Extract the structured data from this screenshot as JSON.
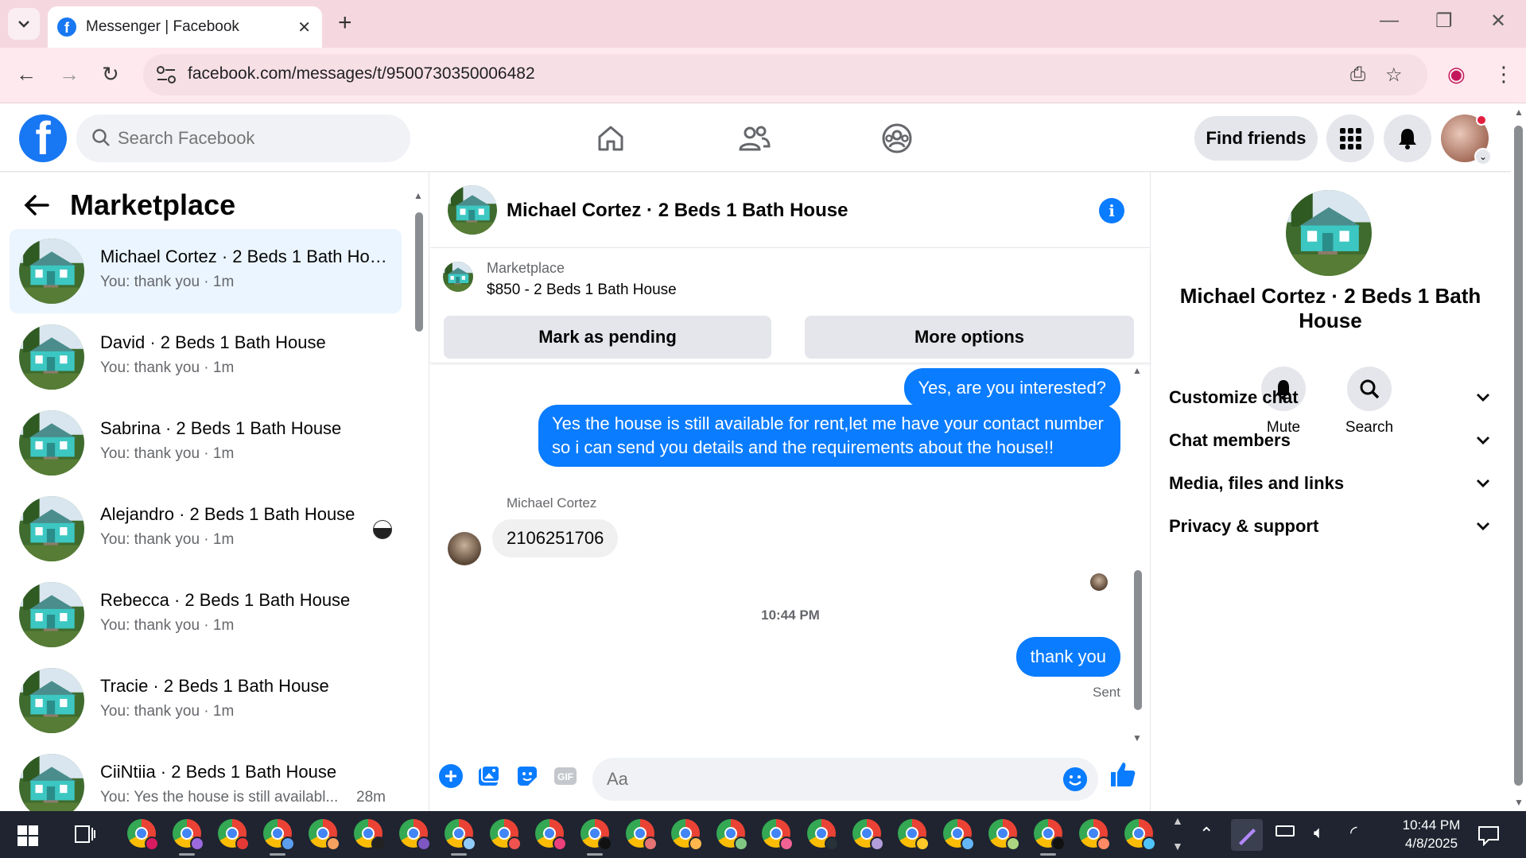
{
  "browser": {
    "tab_title": "Messenger | Facebook",
    "url": "facebook.com/messages/t/9500730350006482"
  },
  "header": {
    "search_placeholder": "Search Facebook",
    "find_friends": "Find friends"
  },
  "left": {
    "title": "Marketplace",
    "conversations": [
      {
        "name": "Michael Cortez · 2 Beds 1 Bath House",
        "preview": "You: thank you · 1m",
        "time": "",
        "active": true
      },
      {
        "name": "David · 2 Beds 1 Bath House",
        "preview": "You: thank you · 1m",
        "time": ""
      },
      {
        "name": "Sabrina · 2 Beds 1 Bath House",
        "preview": "You: thank you · 1m",
        "time": ""
      },
      {
        "name": "Alejandro · 2 Beds 1 Bath House",
        "preview": "You: thank you · 1m",
        "time": ""
      },
      {
        "name": "Rebecca · 2 Beds 1 Bath House",
        "preview": "You: thank you · 1m",
        "time": ""
      },
      {
        "name": "Tracie · 2 Beds 1 Bath House",
        "preview": "You: thank you · 1m",
        "time": ""
      },
      {
        "name": "CiiNtiia · 2 Beds 1 Bath House",
        "preview": "You: Yes the house is still availabl...",
        "time": "28m"
      }
    ]
  },
  "chat": {
    "title": "Michael Cortez · 2 Beds 1 Bath House",
    "listing_kind": "Marketplace",
    "listing_price": "$850 - 2 Beds 1 Bath House",
    "mark_pending": "Mark as pending",
    "more_options": "More options",
    "msg1": "Yes, are you interested?",
    "msg2": "Yes the house is still available for rent,let me have your contact number so i can send you details and the requirements about the house!!",
    "sender": "Michael Cortez",
    "msg3": "2106251706",
    "timestamp": "10:44 PM",
    "msg4": "thank you",
    "sent": "Sent",
    "composer_placeholder": "Aa"
  },
  "right": {
    "name": "Michael Cortez · 2 Beds 1 Bath House",
    "mute": "Mute",
    "search": "Search",
    "sections": [
      "Customize chat",
      "Chat members",
      "Media, files and links",
      "Privacy & support"
    ]
  },
  "taskbar": {
    "time": "10:44 PM",
    "date": "4/8/2025"
  },
  "colors": {
    "brand": "#1877f2",
    "bubble": "#0a7cff",
    "active_conv": "#ebf5ff"
  }
}
